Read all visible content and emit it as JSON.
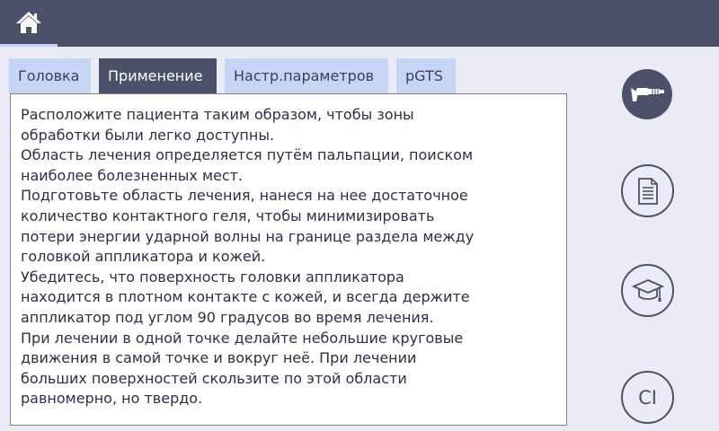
{
  "header": {
    "home_icon": "home-icon"
  },
  "tabs": [
    {
      "label": "Головка",
      "active": false
    },
    {
      "label": "Применение",
      "active": true
    },
    {
      "label": "Настр.параметров",
      "active": false
    },
    {
      "label": "pGTS",
      "active": false
    }
  ],
  "content": {
    "lines": [
      "Расположите пациента таким образом, чтобы зоны",
      "обработки были легко доступны.",
      "Область лечения определяется путём пальпации, поиском",
      "наиболее болезненных мест.",
      "Подготовьте область лечения, нанеся на нее достаточное",
      "количество контактного геля, чтобы минимизировать",
      "потери энергии ударной волны на границе раздела между",
      "головкой аппликатора и кожей.",
      "Убедитесь, что поверхность головки аппликатора",
      "находится в плотном контакте с кожей, и всегда держите",
      "аппликатор под углом 90 градусов во время лечения.",
      "При лечении в одной точке делайте небольшие круговые",
      "движения в самой точке и вокруг неё. При лечении",
      "больших поверхностей скользите по этой области",
      "равномерно, но твердо."
    ]
  },
  "sidebar": {
    "applicator_icon": "applicator-icon",
    "document_icon": "document-icon",
    "education_icon": "graduation-cap-icon",
    "ci_label": "CI"
  },
  "colors": {
    "topbar": "#4b5168",
    "tab": "#c7d5f4",
    "tab_active": "#4b5168",
    "background": "#ebebf5"
  }
}
